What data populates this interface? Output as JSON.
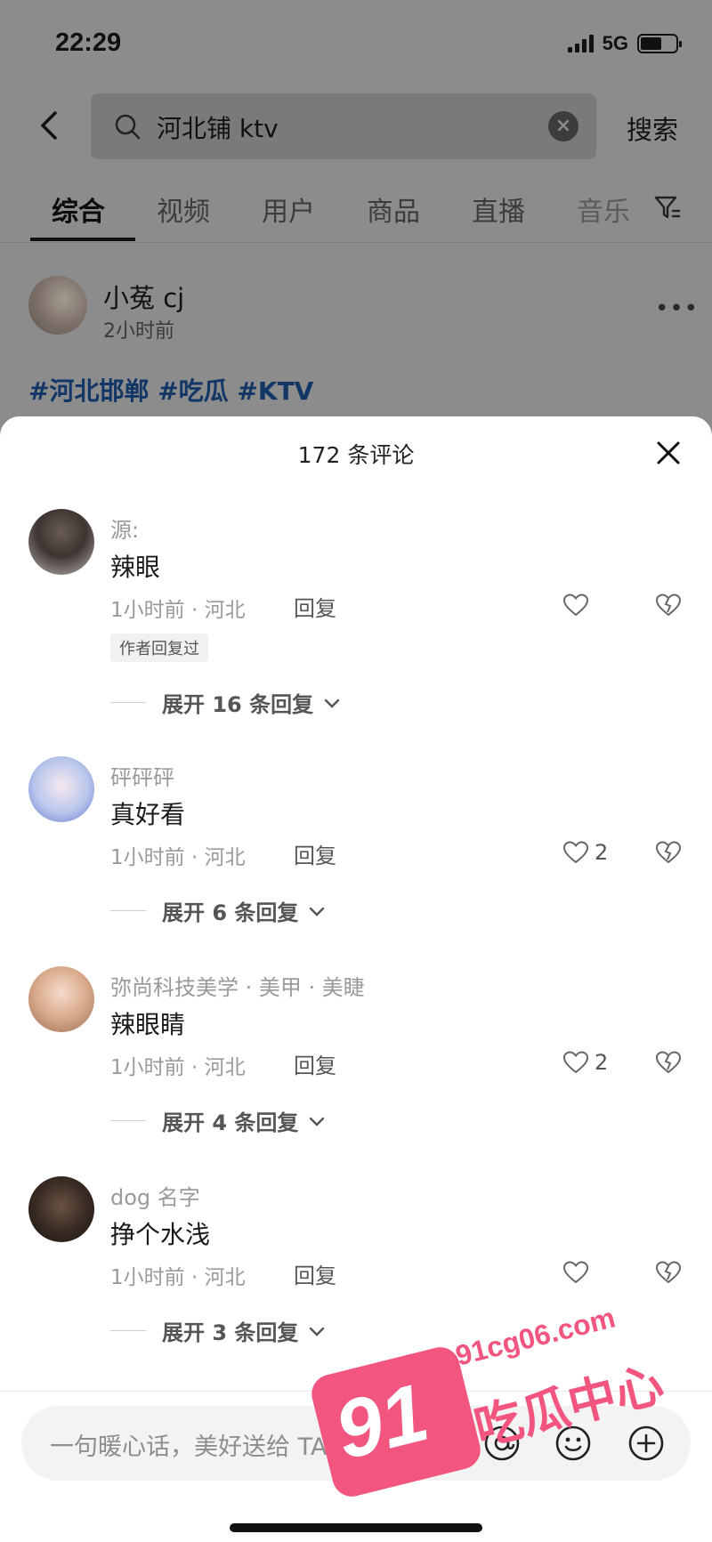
{
  "status": {
    "time": "22:29",
    "network": "5G"
  },
  "search": {
    "query": "河北铺 ktv",
    "submit_label": "搜索"
  },
  "tabs": [
    {
      "label": "综合"
    },
    {
      "label": "视频"
    },
    {
      "label": "用户"
    },
    {
      "label": "商品"
    },
    {
      "label": "直播"
    },
    {
      "label": "音乐"
    }
  ],
  "post": {
    "user": "小菟 cj",
    "time": "2小时前",
    "tags": "#河北邯郸 #吃瓜 #KTV"
  },
  "comments_sheet": {
    "title": "172 条评论",
    "items": [
      {
        "user": "源:",
        "text": "辣眼",
        "meta": "1小时前 · 河北",
        "reply_label": "回复",
        "likes": "",
        "badge": "作者回复过",
        "expand": "展开 16 条回复"
      },
      {
        "user": "砰砰砰",
        "text": "真好看",
        "meta": "1小时前 · 河北",
        "reply_label": "回复",
        "likes": "2",
        "expand": "展开 6 条回复"
      },
      {
        "user": "弥尚科技美学 · 美甲 · 美睫",
        "text": "辣眼睛",
        "meta": "1小时前 · 河北",
        "reply_label": "回复",
        "likes": "2",
        "expand": "展开 4 条回复"
      },
      {
        "user": "dog 名字",
        "text": "挣个水浅",
        "meta": "1小时前 · 河北",
        "reply_label": "回复",
        "likes": "",
        "expand": "展开 3 条回复"
      }
    ]
  },
  "input": {
    "placeholder": "一句暖心话，美好送给 TA"
  },
  "watermark": {
    "number": "91",
    "domain": "91cg06.com",
    "name": "吃瓜中心"
  },
  "colors": {
    "accent_pink": "#f2557f",
    "tag_blue": "#123767"
  }
}
